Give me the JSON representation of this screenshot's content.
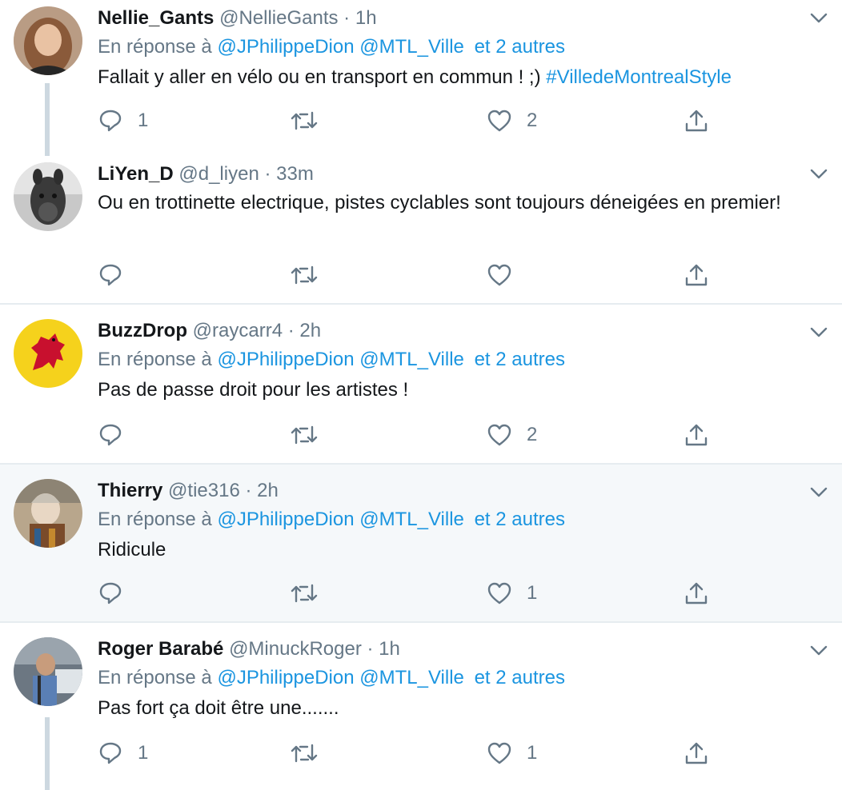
{
  "tweets": [
    {
      "name": "Nellie_Gants",
      "handle": "@NellieGants",
      "time": "1h",
      "reply_label": "En réponse à",
      "mentions": [
        "@JPhilippeDion",
        "@MTL_Ville"
      ],
      "others": "et 2 autres",
      "text": "Fallait y aller en vélo ou en transport en commun ! ;) ",
      "hashtag": "#VilledeMontrealStyle",
      "replies": "1",
      "retweets": "",
      "likes": "2",
      "avatar_bg": "#a9876e"
    },
    {
      "name": "LiYen_D",
      "handle": "@d_liyen",
      "time": "33m",
      "text": "Ou en trottinette electrique, pistes cyclables sont toujours déneigées en premier!",
      "replies": "",
      "retweets": "",
      "likes": "",
      "avatar_bg": "#9a9a9a"
    },
    {
      "name": "BuzzDrop",
      "handle": "@raycarr4",
      "time": "2h",
      "reply_label": "En réponse à",
      "mentions": [
        "@JPhilippeDion",
        "@MTL_Ville"
      ],
      "others": "et 2 autres",
      "text": "Pas de passe droit pour les artistes !",
      "replies": "",
      "retweets": "",
      "likes": "2",
      "avatar_bg": "#f5d21c"
    },
    {
      "name": "Thierry",
      "handle": "@tie316",
      "time": "2h",
      "reply_label": "En réponse à",
      "mentions": [
        "@JPhilippeDion",
        "@MTL_Ville"
      ],
      "others": "et 2 autres",
      "text": "Ridicule",
      "replies": "",
      "retweets": "",
      "likes": "1",
      "avatar_bg": "#b8a68c"
    },
    {
      "name": "Roger Barabé",
      "handle": "@MinuckRoger",
      "time": "1h",
      "reply_label": "En réponse à",
      "mentions": [
        "@JPhilippeDion",
        "@MTL_Ville"
      ],
      "others": "et 2 autres",
      "text": "Pas fort ça doit être une.......",
      "replies": "1",
      "retweets": "",
      "likes": "1",
      "avatar_bg": "#4f5a66"
    }
  ],
  "icons": {
    "reply": "reply-icon",
    "retweet": "retweet-icon",
    "like": "heart-icon",
    "share": "share-icon",
    "more": "chevron-down-icon"
  },
  "colors": {
    "link": "#1b95e0",
    "meta": "#657786",
    "text": "#14171a",
    "highlight_bg": "#f5f8fa",
    "thread_line": "#cdd8e0"
  }
}
